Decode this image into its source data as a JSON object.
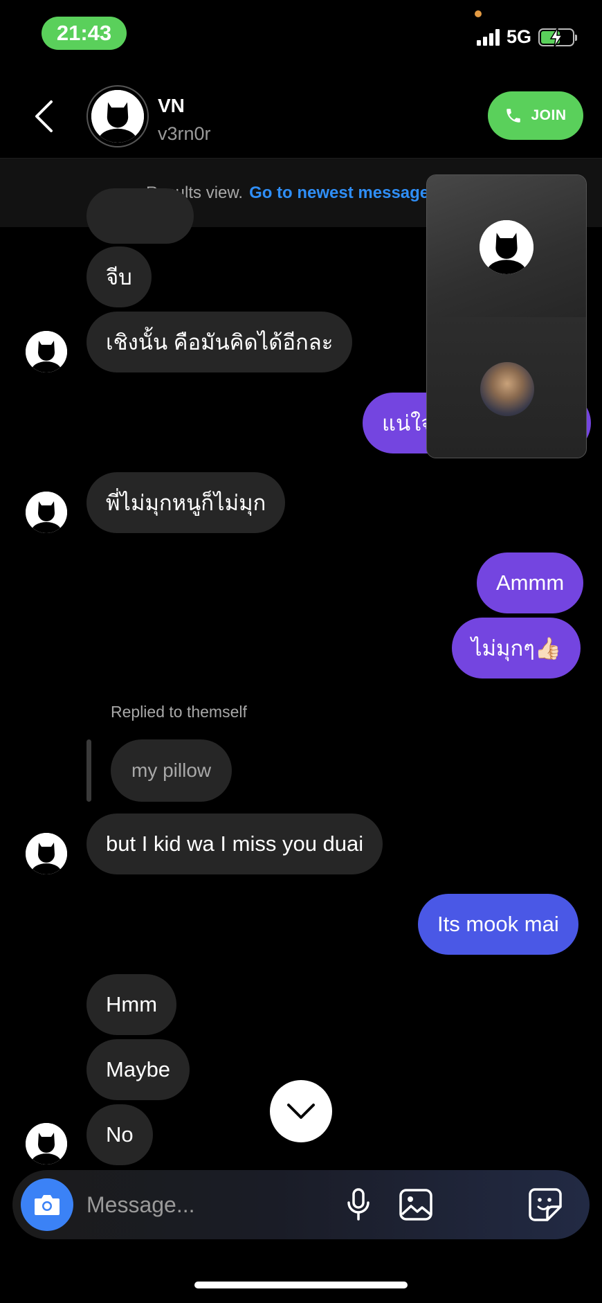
{
  "status_bar": {
    "time": "21:43",
    "network": "5G"
  },
  "header": {
    "name": "VN",
    "username": "v3rn0r",
    "join_label": "JOIN"
  },
  "results_bar": {
    "label": "Results view.",
    "link": "Go to newest messages"
  },
  "messages": [
    {
      "text": "จีบ",
      "side": "received"
    },
    {
      "text": "เชิงนั้น คือมันคิดได้อีกละ",
      "side": "received"
    },
    {
      "text": "แน่ใจ",
      "side": "sent"
    },
    {
      "text": "พี่ไม่มุกหนูก็ไม่มุก",
      "side": "received"
    },
    {
      "text": "Ammm",
      "side": "sent"
    },
    {
      "text": "ไม่มุกๆ👍🏻",
      "side": "sent"
    },
    {
      "text": "but I kid wa I miss you duai",
      "side": "received"
    },
    {
      "text": "Its mook mai",
      "side": "sent"
    },
    {
      "text": "Hmm",
      "side": "received"
    },
    {
      "text": "Maybe",
      "side": "received"
    },
    {
      "text": "No",
      "side": "received"
    }
  ],
  "reply": {
    "meta": "Replied to themself",
    "quoted": "my pillow"
  },
  "composer": {
    "placeholder": "Message..."
  },
  "colors": {
    "join_green": "#5ad05b",
    "link_blue": "#2f8ef6",
    "sent_purple": "#7445e0",
    "sent_blue": "#4a58e6",
    "received_bubble": "#262626"
  },
  "icons": [
    "back-arrow-icon",
    "phone-icon",
    "camera-icon",
    "microphone-icon",
    "gallery-icon",
    "sticker-icon",
    "chevron-down-icon",
    "signal-icon",
    "battery-icon"
  ]
}
